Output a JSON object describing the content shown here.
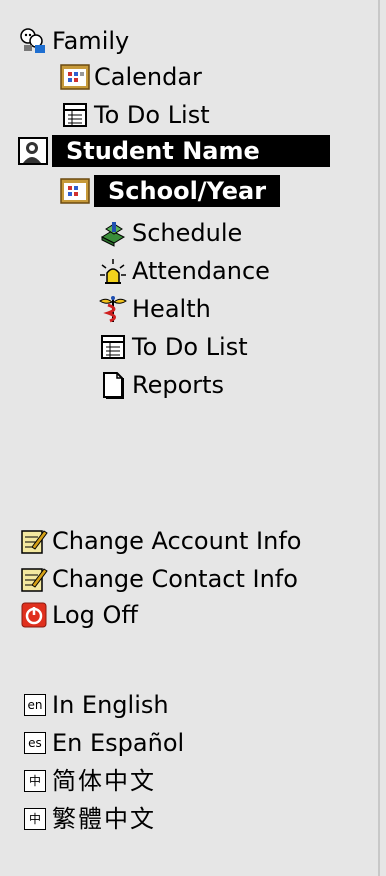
{
  "nav": {
    "family": {
      "label": "Family",
      "icon": "family-people-icon"
    },
    "calendar": {
      "label": "Calendar",
      "icon": "calendar-icon"
    },
    "todo_top": {
      "label": "To Do List",
      "icon": "todo-list-icon"
    },
    "student": {
      "label": "Student Name",
      "icon": "student-avatar-icon"
    },
    "school_year": {
      "label": "School/Year",
      "icon": "calendar-icon"
    },
    "schedule": {
      "label": "Schedule",
      "icon": "schedule-blocks-icon"
    },
    "attendance": {
      "label": "Attendance",
      "icon": "attendance-alert-icon"
    },
    "health": {
      "label": "Health",
      "icon": "health-caduceus-icon"
    },
    "todo_sub": {
      "label": "To Do List",
      "icon": "todo-list-icon"
    },
    "reports": {
      "label": "Reports",
      "icon": "document-icon"
    }
  },
  "account": {
    "change_account": {
      "label": "Change Account Info",
      "icon": "edit-note-icon"
    },
    "change_contact": {
      "label": "Change Contact Info",
      "icon": "edit-note-icon"
    },
    "log_off": {
      "label": "Log Off",
      "icon": "power-icon"
    }
  },
  "languages": [
    {
      "badge": "en",
      "label": "In English"
    },
    {
      "badge": "es",
      "label": "En Español"
    },
    {
      "badge": "中",
      "label": "简体中文"
    },
    {
      "badge": "中",
      "label": "繁體中文"
    }
  ],
  "colors": {
    "background": "#e6e6e6",
    "highlight": "#000000",
    "highlight_text": "#ffffff",
    "logoff": "#e0301e"
  }
}
